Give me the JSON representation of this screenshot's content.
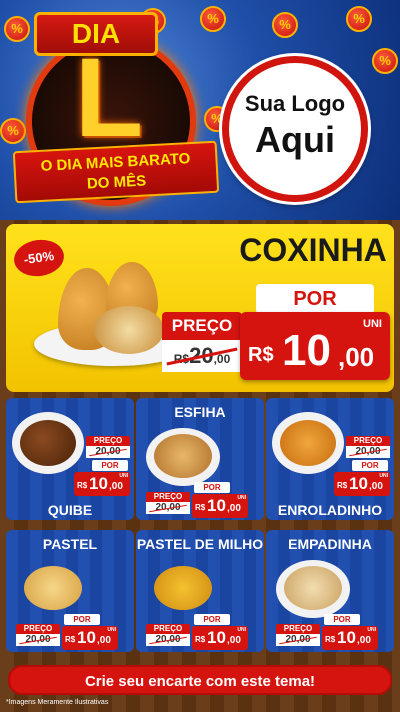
{
  "header": {
    "dia_label": "DIA",
    "big_letter": "L",
    "ribbon_line1": "O DIA MAIS BARATO",
    "ribbon_line2": "DO MÊS",
    "coin_symbol": "%",
    "logo_line1": "Sua Logo",
    "logo_line2": "Aqui"
  },
  "featured": {
    "discount": "-50%",
    "name": "COXINHA",
    "por_label": "POR",
    "preco_label": "PREÇO",
    "old_currency": "R$",
    "old_whole": "20",
    "old_cents": ",00",
    "unit": "UNI",
    "currency": "R$",
    "price_whole": "10",
    "price_cents": ",00"
  },
  "products": [
    {
      "name": "QUIBE",
      "preco_label": "PREÇO",
      "old": "20,00",
      "por_label": "POR",
      "currency": "R$",
      "whole": "10",
      "cents": ",00",
      "unit": "UNI"
    },
    {
      "name": "ESFIHA",
      "preco_label": "PREÇO",
      "old": "20,00",
      "por_label": "POR",
      "currency": "R$",
      "whole": "10",
      "cents": ",00",
      "unit": "UNI"
    },
    {
      "name": "ENROLADINHO",
      "preco_label": "PREÇO",
      "old": "20,00",
      "por_label": "POR",
      "currency": "R$",
      "whole": "10",
      "cents": ",00",
      "unit": "UNI"
    },
    {
      "name": "PASTEL",
      "preco_label": "PREÇO",
      "old": "20,00",
      "por_label": "POR",
      "currency": "R$",
      "whole": "10",
      "cents": ",00",
      "unit": "UNI"
    },
    {
      "name": "PASTEL DE MILHO",
      "preco_label": "PREÇO",
      "old": "20,00",
      "por_label": "POR",
      "currency": "R$",
      "whole": "10",
      "cents": ",00",
      "unit": "UNI"
    },
    {
      "name": "EMPADINHA",
      "preco_label": "PREÇO",
      "old": "20,00",
      "por_label": "POR",
      "currency": "R$",
      "whole": "10",
      "cents": ",00",
      "unit": "UNI"
    }
  ],
  "footer": {
    "cta": "Crie seu encarte com este tema!",
    "disclaimer": "*Imagens Meramente Ilustrativas"
  },
  "colors": {
    "brand_red": "#d5140f",
    "brand_yellow": "#ffe21b",
    "card_blue": "#1e4aa8"
  }
}
